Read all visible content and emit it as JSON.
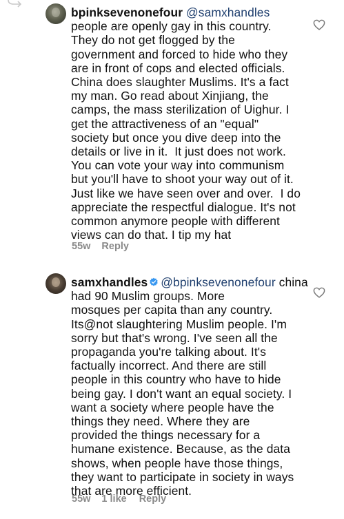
{
  "comments": [
    {
      "username": "bpinksevenonefour",
      "mention": "@samxhandles",
      "verified": false,
      "text": "people are openly gay in this country.\nThey do not get flogged by the\ngovernment and forced to hide who they\nare in front of cops and elected officials.\nChina does slaughter Muslims. It's a fact\nmy man. Go read about Xinjiang, the\ncamps, the mass sterilization of Uighur. I\nget the attractiveness of an \"equal\"\nsociety but once you dive deep into the\ndetails or live in it.  It just does not work.\nYou can vote your way into communism\nbut you'll have to shoot your way out of it.\nJust like we have seen over and over.  I do\nappreciate the respectful dialogue. It's not\ncommon anymore people with different\nviews can do that. I tip my hat",
      "time": "55w",
      "likes": "",
      "reply_label": "Reply",
      "icons": {
        "like": "heart-outline-icon",
        "avatar": "avatar-photo"
      }
    },
    {
      "username": "samxhandles",
      "mention": "@bpinksevenonefour",
      "verified": true,
      "text": "china had 90 Muslim groups. More\nmosques per capita than any country.\nIts@not slaughtering Muslim people. I'm\nsorry but that's wrong. I've seen all the\npropaganda you're talking about. It's\nfactually incorrect. And there are still\npeople in this country who have to hide\nbeing gay. I don't want an equal society. I\nwant a society where people have the\nthings they need. Where they are\nprovided the things necessary for a\nhumane existence. Because, as the data\nshows, when people have those things,\nthey want to participate in society in ways\nthat are more efficient.",
      "time": "55w",
      "likes": "1 like",
      "reply_label": "Reply",
      "icons": {
        "like": "heart-outline-icon",
        "verified": "verified-badge-icon",
        "avatar": "avatar-photo"
      }
    }
  ],
  "colors": {
    "text": "#111111",
    "mention": "#1f3f6e",
    "meta": "#8a8a8a",
    "verified": "#3897f0",
    "icon": "#7a7a7a"
  }
}
